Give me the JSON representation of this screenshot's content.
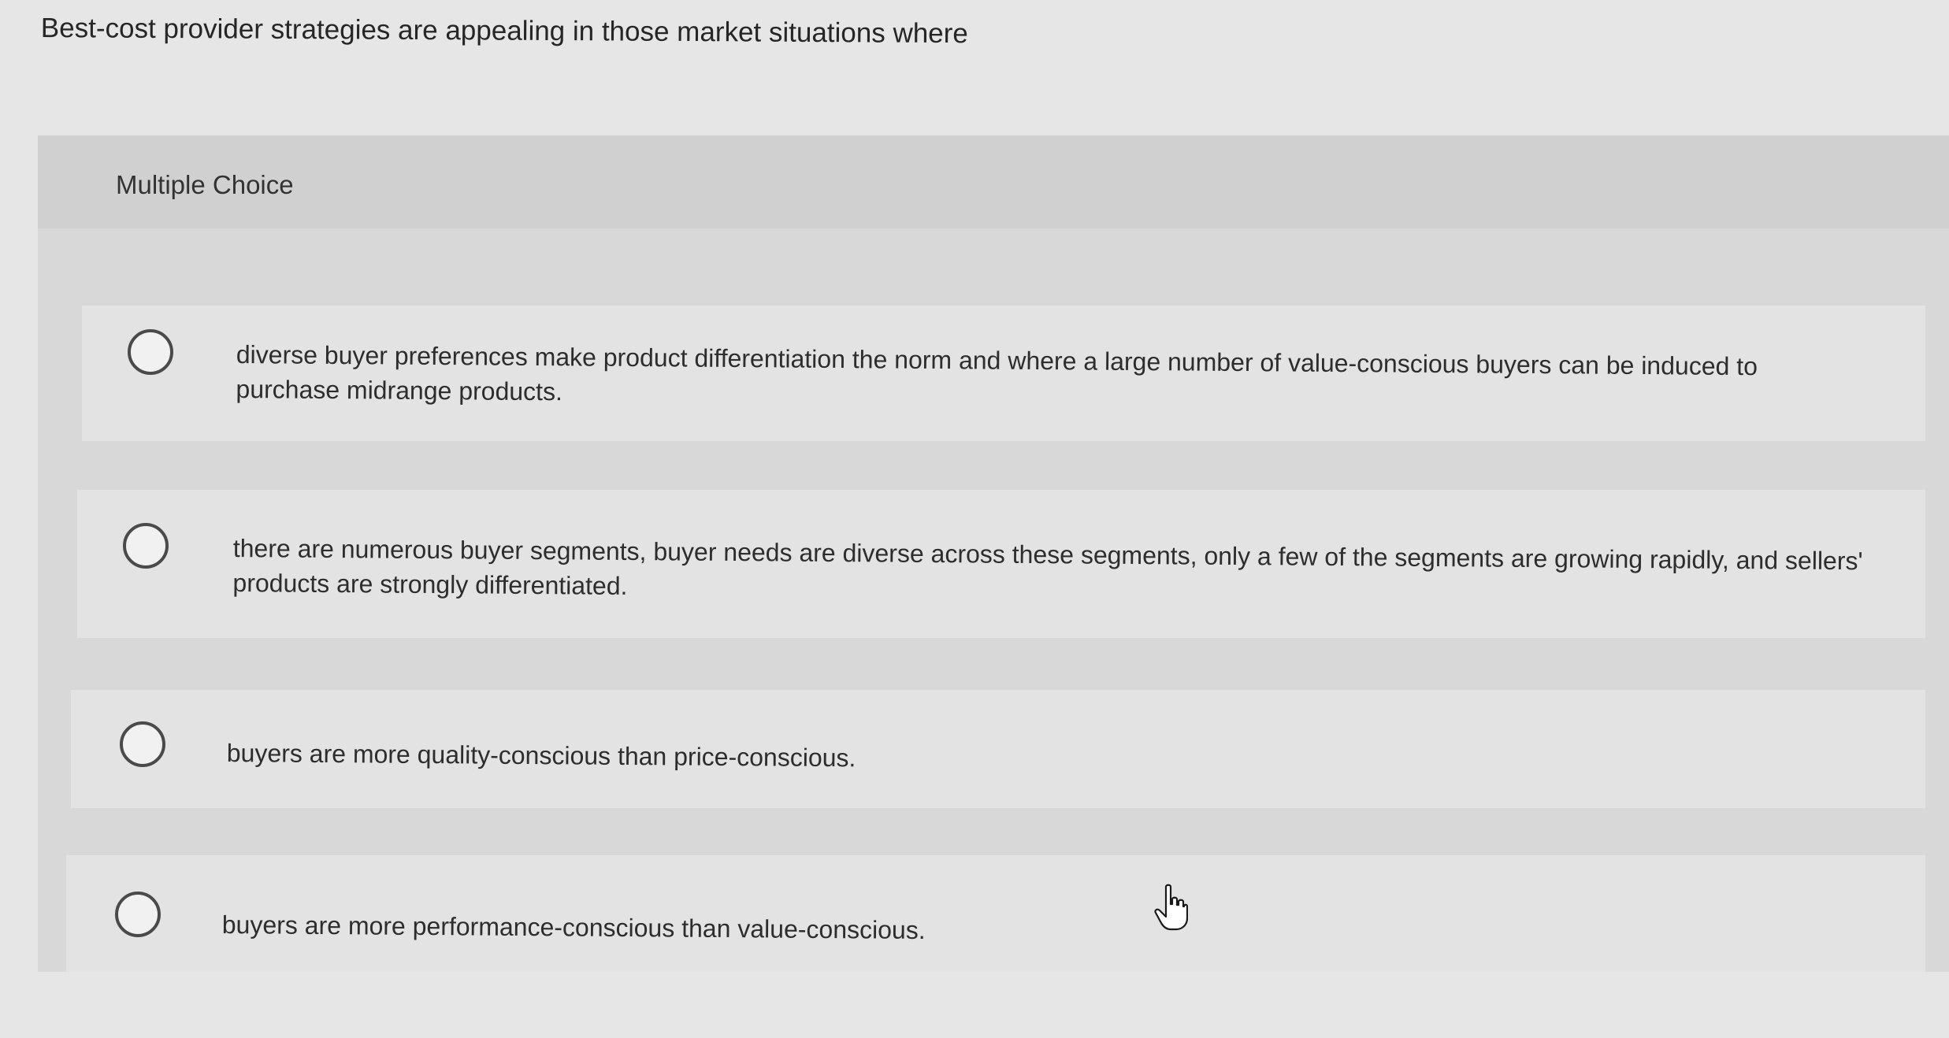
{
  "question": {
    "stem": "Best-cost provider strategies are appealing in those market situations where"
  },
  "answer_panel": {
    "type_label": "Multiple Choice",
    "choices": [
      {
        "text": "diverse buyer preferences make product differentiation the norm and where a large number of value-conscious buyers can be induced to purchase midrange products.",
        "selected": false
      },
      {
        "text": "there are numerous buyer segments, buyer needs are diverse across these segments, only a few of the segments are growing rapidly, and sellers' products are strongly differentiated.",
        "selected": false
      },
      {
        "text": "buyers are more quality-conscious than price-conscious.",
        "selected": false
      },
      {
        "text": "buyers are more performance-conscious than value-conscious.",
        "selected": false
      }
    ]
  },
  "icons": {
    "cursor": "hand-pointer-icon",
    "radio": "radio-unchecked-icon"
  },
  "colors": {
    "background": "#e6e6e6",
    "panel": "#d8d8d8",
    "choice_background": "#e3e3e3",
    "text": "#2d2d2d"
  }
}
